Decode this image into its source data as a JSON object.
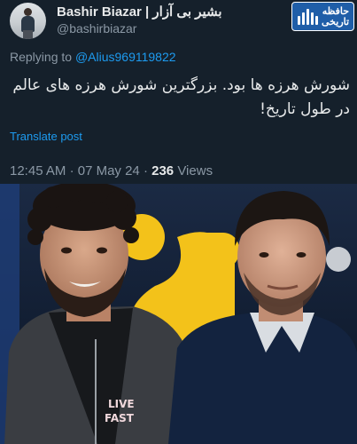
{
  "author": {
    "display_name": "Bashir Biazar | بشیر بی آزار",
    "handle": "@bashirbiazar"
  },
  "badge": {
    "text_line1": "حافظه",
    "text_line2": "تاریخی",
    "background": "#1f5ea8"
  },
  "reply": {
    "prefix": "Replying to",
    "mention": "@Alius969119822"
  },
  "tweet": {
    "text": "شورش هرزه ها بود. بزرگترین شورش هرزه های عالم در طول تاریخ!"
  },
  "translate_label": "Translate post",
  "meta": {
    "time": "12:45 AM",
    "date": "07 May 24",
    "views_count": "236",
    "views_label": "Views"
  },
  "photo": {
    "shirt_text_line1": "LIVE",
    "shirt_text_line2": "FAST"
  },
  "colors": {
    "background": "#15202b",
    "text": "#e7e9ea",
    "secondary": "#8b98a5",
    "link": "#1d9bf0",
    "photo_yellow": "#f3c21a"
  }
}
